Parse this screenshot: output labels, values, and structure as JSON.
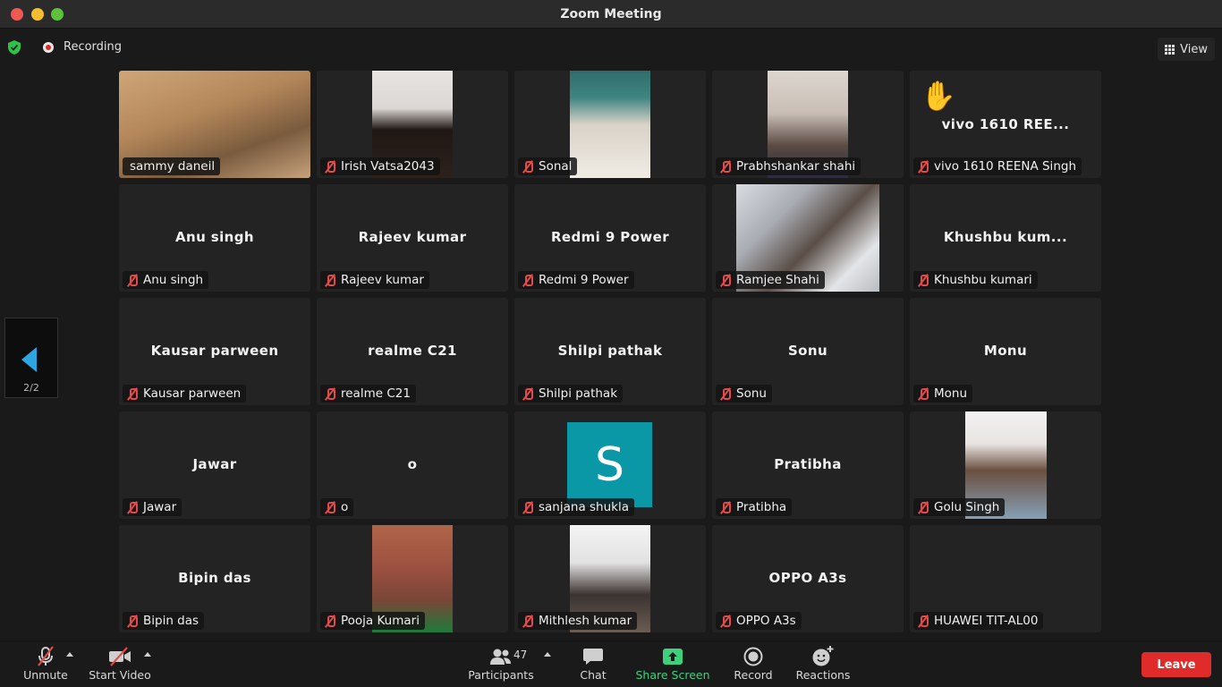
{
  "window": {
    "title": "Zoom Meeting"
  },
  "topbar": {
    "recording_label": "Recording",
    "view_label": "View"
  },
  "pager": {
    "label": "2/2"
  },
  "tiles": [
    {
      "name": "sammy daneil",
      "muted": false,
      "kind": "video",
      "video": "sammy"
    },
    {
      "name": "Irish Vatsa2043",
      "muted": true,
      "kind": "video",
      "video": "irish"
    },
    {
      "name": "Sonal",
      "muted": true,
      "kind": "video",
      "video": "sonal"
    },
    {
      "name": "Prabhshankar shahi",
      "muted": true,
      "kind": "video",
      "video": "prabh"
    },
    {
      "name": "vivo 1610 REENA Singh",
      "muted": true,
      "kind": "hand",
      "display": "vivo 1610 REE..."
    },
    {
      "name": "Anu singh",
      "muted": true,
      "kind": "name",
      "display": "Anu singh"
    },
    {
      "name": "Rajeev kumar",
      "muted": true,
      "kind": "name",
      "display": "Rajeev kumar"
    },
    {
      "name": "Redmi 9 Power",
      "muted": true,
      "kind": "name",
      "display": "Redmi 9 Power"
    },
    {
      "name": "Ramjee Shahi",
      "muted": true,
      "kind": "video",
      "video": "ramjee"
    },
    {
      "name": "Khushbu kumari",
      "muted": true,
      "kind": "name",
      "display": "Khushbu kum..."
    },
    {
      "name": "Kausar parween",
      "muted": true,
      "kind": "name",
      "display": "Kausar parween"
    },
    {
      "name": "realme C21",
      "muted": true,
      "kind": "name",
      "display": "realme C21"
    },
    {
      "name": "Shilpi pathak",
      "muted": true,
      "kind": "name",
      "display": "Shilpi pathak"
    },
    {
      "name": "Sonu",
      "muted": true,
      "kind": "name",
      "display": "Sonu"
    },
    {
      "name": "Monu",
      "muted": true,
      "kind": "name",
      "display": "Monu"
    },
    {
      "name": "Jawar",
      "muted": true,
      "kind": "name",
      "display": "Jawar"
    },
    {
      "name": "o",
      "muted": true,
      "kind": "name",
      "display": "o"
    },
    {
      "name": "sanjana shukla",
      "muted": true,
      "kind": "avatar",
      "avatar_letter": "S"
    },
    {
      "name": "Pratibha",
      "muted": true,
      "kind": "name",
      "display": "Pratibha"
    },
    {
      "name": "Golu Singh",
      "muted": true,
      "kind": "video",
      "video": "golu"
    },
    {
      "name": "Bipin das",
      "muted": true,
      "kind": "name",
      "display": "Bipin das"
    },
    {
      "name": "Pooja Kumari",
      "muted": true,
      "kind": "video",
      "video": "pooja"
    },
    {
      "name": "Mithlesh kumar",
      "muted": true,
      "kind": "video",
      "video": "mithlesh"
    },
    {
      "name": "OPPO A3s",
      "muted": true,
      "kind": "name",
      "display": "OPPO A3s"
    },
    {
      "name": "HUAWEI TIT-AL00",
      "muted": true,
      "kind": "blank"
    }
  ],
  "toolbar": {
    "unmute_label": "Unmute",
    "start_video_label": "Start Video",
    "participants_label": "Participants",
    "participants_count": "47",
    "chat_label": "Chat",
    "share_screen_label": "Share Screen",
    "record_label": "Record",
    "reactions_label": "Reactions",
    "leave_label": "Leave"
  },
  "colors": {
    "accent_share": "#3fd07f",
    "leave_red": "#e02b2b",
    "avatar_teal": "#0a97a6",
    "pager_blue": "#2da5e0",
    "mute_red": "#e34a4a"
  }
}
